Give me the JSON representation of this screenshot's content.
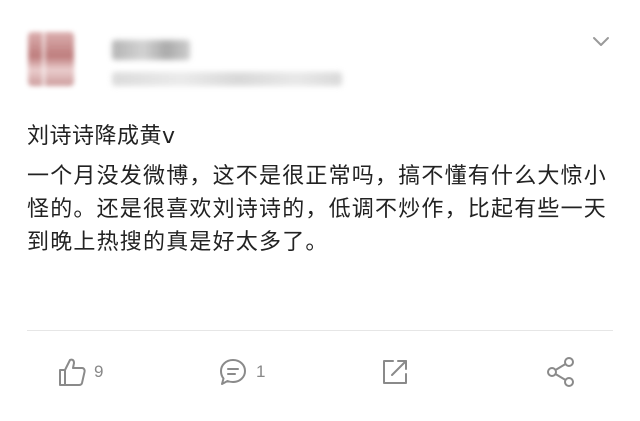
{
  "post": {
    "title": "刘诗诗降成黄v",
    "body": "一个月没发微博，这不是很正常吗，搞不懂有什么大惊小怪的。还是很喜欢刘诗诗的，低调不炒作，比起有些一天到晚上热搜的真是好太多了。"
  },
  "actions": {
    "like_count": "9",
    "comment_count": "1"
  },
  "icons": {
    "menu": "chevron-down-icon",
    "like": "thumbs-up-icon",
    "comment": "comment-bubble-icon",
    "repost": "repost-arrow-icon",
    "share": "share-nodes-icon"
  },
  "colors": {
    "text": "#222222",
    "icon": "#8a8a8a",
    "count": "#888888",
    "divider": "#e6e6e6"
  }
}
